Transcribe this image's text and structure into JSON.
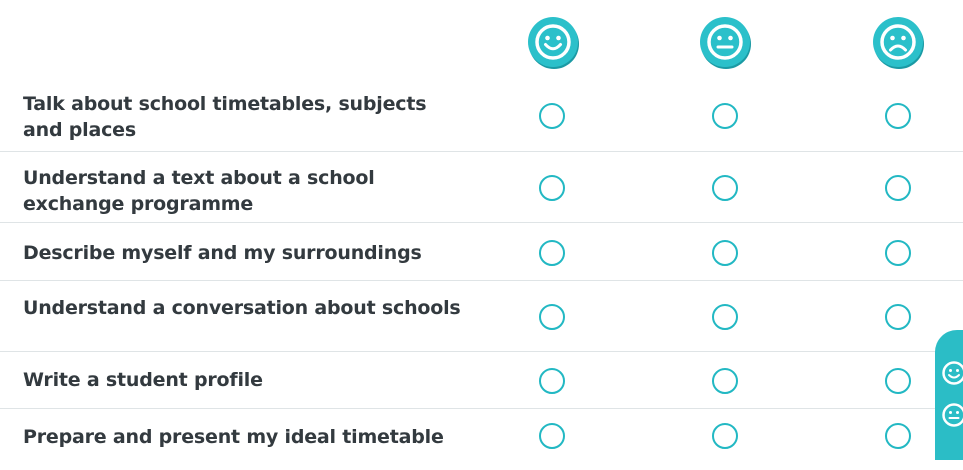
{
  "columns": [
    {
      "icon": "happy-face-icon"
    },
    {
      "icon": "neutral-face-icon"
    },
    {
      "icon": "sad-face-icon"
    }
  ],
  "rows": [
    {
      "label": "Talk about school timetables, subjects and places"
    },
    {
      "label": "Understand a text about a school exchange programme"
    },
    {
      "label": "Describe myself and my surroundings"
    },
    {
      "label": "Understand a conversation about schools"
    },
    {
      "label": "Write a student profile"
    },
    {
      "label": "Prepare and present my ideal timetable"
    }
  ],
  "colors": {
    "accent": "#22b8c3",
    "text": "#333a3f",
    "divider": "#dfe4e6"
  }
}
